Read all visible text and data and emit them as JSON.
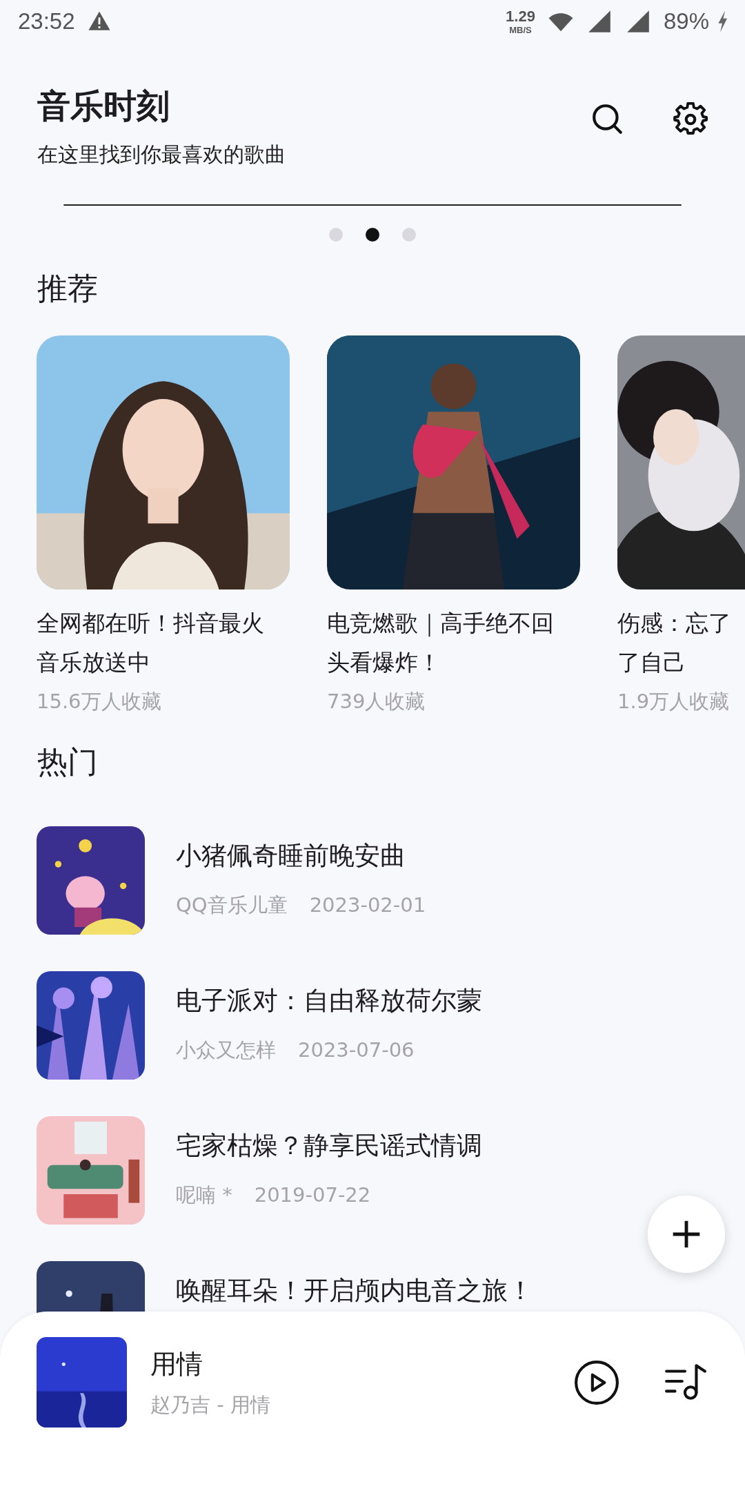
{
  "status_bar": {
    "time": "23:52",
    "speed": "1.29",
    "speed_unit": "MB/S",
    "battery": "89%"
  },
  "header": {
    "title": "音乐时刻",
    "subtitle": "在这里找到你最喜欢的歌曲"
  },
  "banner_dots": [
    {
      "selected": false
    },
    {
      "selected": true
    },
    {
      "selected": false
    }
  ],
  "recommend": {
    "heading": "推荐",
    "cards": [
      {
        "title_lines": [
          "全网都在听！抖音最火",
          "音乐放送中"
        ],
        "count": "15.6万人收藏"
      },
      {
        "title_lines": [
          "电竞燃歌｜高手绝不回",
          "头看爆炸！"
        ],
        "count": "739人收藏"
      },
      {
        "title_lines": [
          "伤感：忘了",
          "了自己"
        ],
        "count": "1.9万人收藏"
      }
    ]
  },
  "hot": {
    "heading": "热门",
    "songs": [
      {
        "title": "小猪佩奇睡前晚安曲",
        "artist": "QQ音乐儿童",
        "date": "2023-02-01"
      },
      {
        "title": "电子派对：自由释放荷尔蒙",
        "artist": "小众又怎样",
        "date": "2023-07-06"
      },
      {
        "title": "宅家枯燥？静享民谣式情调",
        "artist": "呢喃 *",
        "date": "2019-07-22"
      },
      {
        "title": "唤醒耳朵！开启颅内电音之旅！"
      }
    ]
  },
  "player": {
    "title": "用情",
    "subtitle": "赵乃吉 - 用情"
  }
}
